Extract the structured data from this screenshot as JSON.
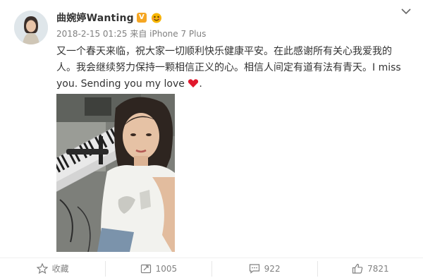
{
  "post": {
    "username": "曲婉婷Wanting",
    "verified_badge": "V",
    "timestamp": "2018-2-15 01:25",
    "source": "来自 iPhone 7 Plus",
    "text": "又一个春天来临，祝大家一切顺利快乐健康平安。在此感谢所有关心我爱我的人。我会继续努力保持一颗相信正义的心。相信人间定有道有法有青天。I miss you. Sending you my love",
    "text_end": "."
  },
  "actions": {
    "favorite_label": "收藏",
    "repost_count": "1005",
    "comment_count": "922",
    "like_count": "7821"
  },
  "icons": {
    "menu": "chevron-down-icon",
    "favorite": "star-icon",
    "repost": "repost-icon",
    "comment": "comment-icon",
    "like": "thumbs-up-icon",
    "heart": "heart-icon"
  },
  "colors": {
    "username": "#333333",
    "meta": "#808080",
    "heart": "#e0182c",
    "badge": "#f5a623"
  }
}
